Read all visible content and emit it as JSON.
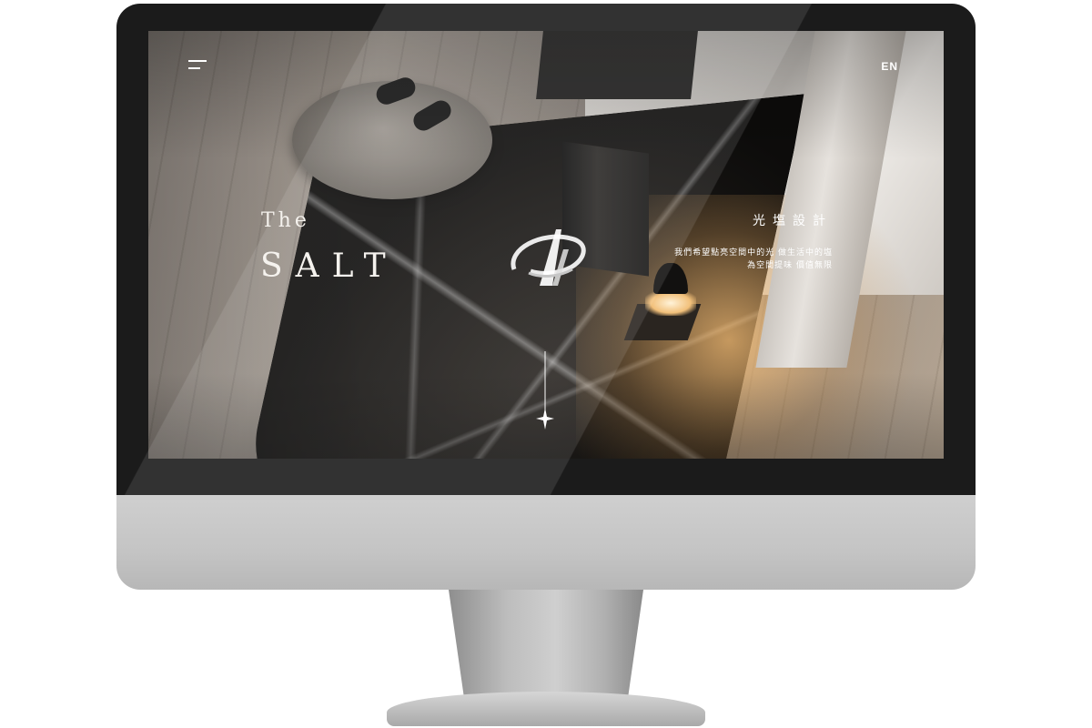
{
  "header": {
    "menu_icon": "menu-icon",
    "language_toggle": "EN"
  },
  "hero": {
    "brand_line1": "The",
    "brand_line2": "SALT",
    "logo_icon": "salt-monogram-logo",
    "title_cn": "光塩設計",
    "tagline_line1": "我們希望點亮空間中的光 做生活中的塩",
    "tagline_line2": "為空間提味 價值無限",
    "scroll_indicator_icon": "sparkle-scroll-icon"
  },
  "colors": {
    "text": "#ffffff",
    "bezel": "#1b1b1b",
    "chin": "#c4c4c4"
  }
}
